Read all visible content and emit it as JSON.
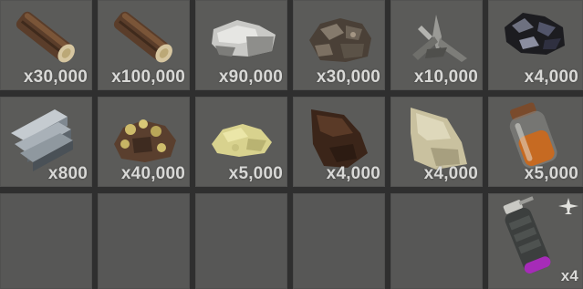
{
  "inventory": {
    "slots": [
      {
        "item": "wood",
        "icon": "wood-log-icon",
        "quantity": "x30,000"
      },
      {
        "item": "wood",
        "icon": "wood-log-icon",
        "quantity": "x100,000"
      },
      {
        "item": "stones",
        "icon": "stones-icon",
        "quantity": "x90,000"
      },
      {
        "item": "metal ore",
        "icon": "metal-ore-icon",
        "quantity": "x30,000"
      },
      {
        "item": "metal fragments",
        "icon": "metal-fragments-icon",
        "quantity": "x10,000"
      },
      {
        "item": "charcoal",
        "icon": "charcoal-icon",
        "quantity": "x4,000"
      },
      {
        "item": "high quality metal",
        "icon": "hq-metal-bars-icon",
        "quantity": "x800"
      },
      {
        "item": "sulfur ore",
        "icon": "sulfur-ore-icon",
        "quantity": "x40,000"
      },
      {
        "item": "sulfur",
        "icon": "sulfur-icon",
        "quantity": "x5,000"
      },
      {
        "item": "leather",
        "icon": "leather-icon",
        "quantity": "x4,000"
      },
      {
        "item": "cloth",
        "icon": "cloth-icon",
        "quantity": "x4,000"
      },
      {
        "item": "low grade fuel",
        "icon": "fuel-jar-icon",
        "quantity": "x5,000"
      },
      {
        "item": "",
        "icon": "",
        "quantity": ""
      },
      {
        "item": "",
        "icon": "",
        "quantity": ""
      },
      {
        "item": "",
        "icon": "",
        "quantity": ""
      },
      {
        "item": "",
        "icon": "",
        "quantity": ""
      },
      {
        "item": "",
        "icon": "",
        "quantity": ""
      },
      {
        "item": "supply signal",
        "icon": "supply-signal-grenade-icon",
        "quantity": "x4",
        "modifier_icon": "airplane-icon"
      }
    ]
  }
}
